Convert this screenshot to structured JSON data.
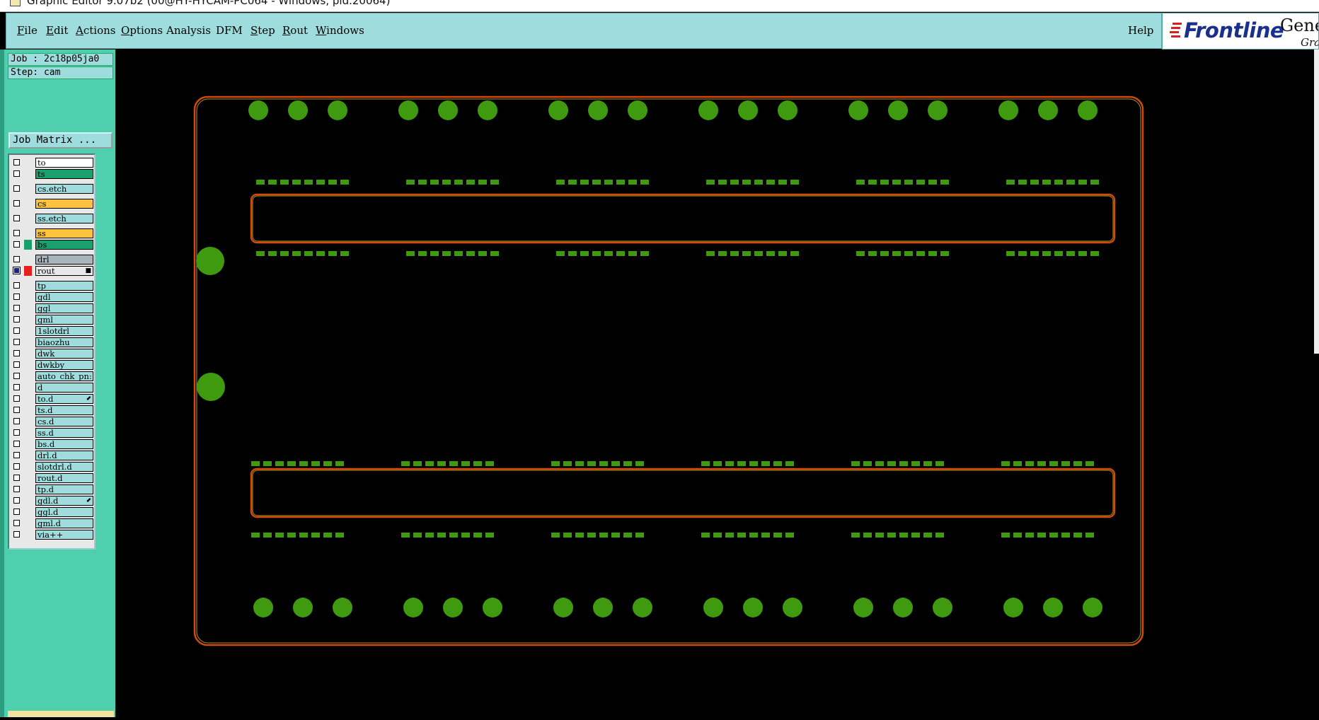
{
  "window": {
    "title": "Graphic Editor 9.07b2 (00@HY-HYCAM-PC064 - Windows, pid.20064)"
  },
  "menu": [
    {
      "pre": "",
      "u": "F",
      "post": "ile"
    },
    {
      "pre": "",
      "u": "E",
      "post": "dit"
    },
    {
      "pre": "",
      "u": "A",
      "post": "ctions"
    },
    {
      "pre": "",
      "u": "O",
      "post": "ptions"
    },
    {
      "pre": "",
      "u": "",
      "post": "Analysis"
    },
    {
      "pre": "",
      "u": "",
      "post": "DFM"
    },
    {
      "pre": "",
      "u": "S",
      "post": "tep"
    },
    {
      "pre": "",
      "u": "R",
      "post": "out"
    },
    {
      "pre": "",
      "u": "W",
      "post": "indows"
    }
  ],
  "help_label": "Help",
  "logo": {
    "brand": "Frontline",
    "product": "Gene",
    "sub": "Grap"
  },
  "job": "Job : 2c18p05ja0",
  "step": "Step: cam",
  "job_matrix_label": "Job Matrix ...",
  "layers": [
    {
      "name": "to",
      "color": "#ffffff",
      "swatch": ""
    },
    {
      "name": "ts",
      "color": "#1aa06e",
      "swatch": ""
    },
    {
      "name": "cs.etch",
      "color": "#9fdcdd",
      "swatch": ""
    },
    {
      "name": "cs",
      "color": "#fbc33f",
      "swatch": ""
    },
    {
      "name": "ss.etch",
      "color": "#9fdcdd",
      "swatch": ""
    },
    {
      "name": "ss",
      "color": "#fbc33f",
      "swatch": ""
    },
    {
      "name": "bs",
      "color": "#1aa06e",
      "swatch": "#1aa06e"
    },
    {
      "name": "drl",
      "color": "#a9b5bd",
      "swatch": ""
    },
    {
      "name": "rout",
      "color": "#e8e8e8",
      "swatch": "#e61e1e",
      "checked": true,
      "mark": "■"
    },
    {
      "name": "tp",
      "color": "#9fdcdd",
      "swatch": ""
    },
    {
      "name": "gdl",
      "color": "#9fdcdd",
      "swatch": ""
    },
    {
      "name": "ggl",
      "color": "#9fdcdd",
      "swatch": ""
    },
    {
      "name": "gml",
      "color": "#9fdcdd",
      "swatch": ""
    },
    {
      "name": "1slotdrl",
      "color": "#9fdcdd",
      "swatch": ""
    },
    {
      "name": "biaozhu",
      "color": "#9fdcdd",
      "swatch": ""
    },
    {
      "name": "dwk",
      "color": "#9fdcdd",
      "swatch": ""
    },
    {
      "name": "dwkby",
      "color": "#9fdcdd",
      "swatch": ""
    },
    {
      "name": "auto_chk_pn:",
      "color": "#9fdcdd",
      "swatch": ""
    },
    {
      "name": "d",
      "color": "#9fdcdd",
      "swatch": ""
    },
    {
      "name": "to.d",
      "color": "#9fdcdd",
      "swatch": "",
      "mark": "⬋"
    },
    {
      "name": "ts.d",
      "color": "#9fdcdd",
      "swatch": ""
    },
    {
      "name": "cs.d",
      "color": "#9fdcdd",
      "swatch": ""
    },
    {
      "name": "ss.d",
      "color": "#9fdcdd",
      "swatch": ""
    },
    {
      "name": "bs.d",
      "color": "#9fdcdd",
      "swatch": ""
    },
    {
      "name": "drl.d",
      "color": "#9fdcdd",
      "swatch": ""
    },
    {
      "name": "slotdrl.d",
      "color": "#9fdcdd",
      "swatch": ""
    },
    {
      "name": "rout.d",
      "color": "#9fdcdd",
      "swatch": ""
    },
    {
      "name": "tp.d",
      "color": "#9fdcdd",
      "swatch": ""
    },
    {
      "name": "gdl.d",
      "color": "#9fdcdd",
      "swatch": "",
      "mark": "⬋"
    },
    {
      "name": "ggl.d",
      "color": "#9fdcdd",
      "swatch": ""
    },
    {
      "name": "gml.d",
      "color": "#9fdcdd",
      "swatch": ""
    },
    {
      "name": "via++",
      "color": "#9fdcdd",
      "swatch": ""
    }
  ],
  "colors": {
    "pad": "#3f9a0f",
    "outline": "#d24a0a",
    "outline_inner": "#b8902a",
    "canvas": "#000000"
  }
}
